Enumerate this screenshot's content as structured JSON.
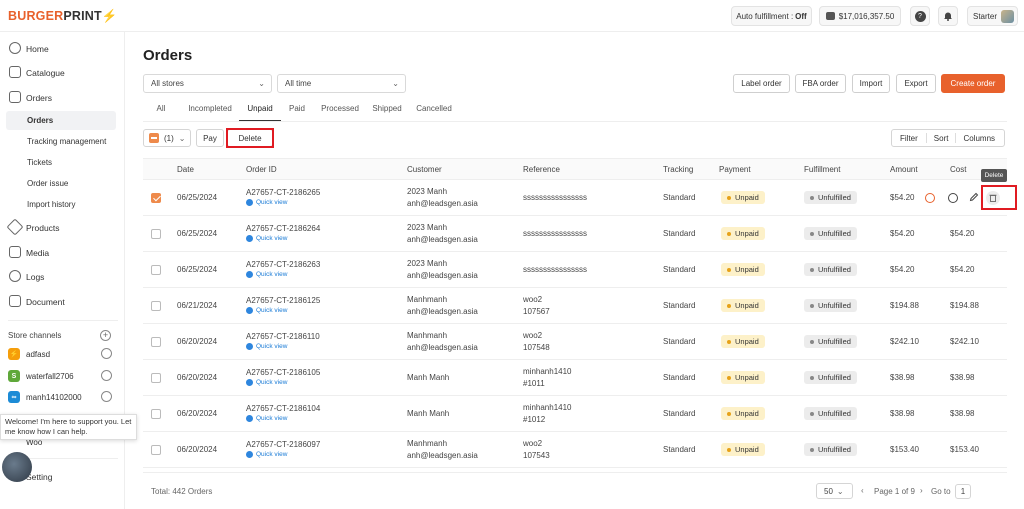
{
  "brand": {
    "name_a": "BURGER",
    "name_b": "PRINT",
    "mark": "⚡"
  },
  "topbar": {
    "auto_fulfillment": "Auto fulfillment : ",
    "auto_fulfillment_state": "Off",
    "balance": "$17,016,357.50",
    "help": "?",
    "plan": "Starter"
  },
  "sidebar": {
    "nav": [
      {
        "label": "Home",
        "icon": "home-icon"
      },
      {
        "label": "Catalogue",
        "icon": "catalogue-icon"
      },
      {
        "label": "Orders",
        "icon": "orders-icon"
      }
    ],
    "orders_sub": [
      "Orders",
      "Tracking management",
      "Tickets",
      "Order issue",
      "Import history"
    ],
    "nav2": [
      {
        "label": "Products",
        "icon": "tag-icon"
      },
      {
        "label": "Media",
        "icon": "image-icon"
      },
      {
        "label": "Logs",
        "icon": "history-icon"
      },
      {
        "label": "Document",
        "icon": "book-icon"
      }
    ],
    "store_channels_label": "Store channels",
    "stores": [
      {
        "name": "adfasd",
        "color": "#f59e0b",
        "glyph": "⚡"
      },
      {
        "name": "waterfall2706",
        "color": "#5fa83a",
        "glyph": "S"
      },
      {
        "name": "manh14102000",
        "color": "#1c8bd6",
        "glyph": "∞"
      }
    ],
    "welcome": "Welcome! I'm here to support you. Let me know how I can help.",
    "hidden_store": "Woo",
    "setting": "Setting"
  },
  "main": {
    "title": "Orders",
    "filters": {
      "store": "All stores",
      "time": "All time"
    },
    "actions": {
      "label_order": "Label order",
      "fba_order": "FBA order",
      "import": "Import",
      "export": "Export",
      "create": "Create order"
    },
    "tabs": [
      "All",
      "Incompleted",
      "Unpaid",
      "Paid",
      "Processed",
      "Shipped",
      "Cancelled"
    ],
    "active_tab": "Unpaid",
    "bulk": {
      "count": "(1)",
      "pay": "Pay",
      "delete": "Delete"
    },
    "view": {
      "filter": "Filter",
      "sort": "Sort",
      "columns": "Columns"
    },
    "columns": [
      "Date",
      "Order ID",
      "Customer",
      "Reference",
      "Tracking",
      "Payment",
      "Fulfillment",
      "Amount",
      "Cost"
    ],
    "quick_view": "Quick view",
    "delete_tooltip": "Delete",
    "rows": [
      {
        "date": "06/25/2024",
        "id": "A27657-CT-2186265",
        "cust1": "2023 Manh",
        "cust2": "anh@leadsgen.asia",
        "ref1": "ssssssssssssssss",
        "ref2": "",
        "tracking": "Standard",
        "payment": "Unpaid",
        "fulfillment": "Unfulfilled",
        "amount": "$54.20",
        "cost": "",
        "checked": true
      },
      {
        "date": "06/25/2024",
        "id": "A27657-CT-2186264",
        "cust1": "2023 Manh",
        "cust2": "anh@leadsgen.asia",
        "ref1": "ssssssssssssssss",
        "ref2": "",
        "tracking": "Standard",
        "payment": "Unpaid",
        "fulfillment": "Unfulfilled",
        "amount": "$54.20",
        "cost": "$54.20",
        "checked": false
      },
      {
        "date": "06/25/2024",
        "id": "A27657-CT-2186263",
        "cust1": "2023 Manh",
        "cust2": "anh@leadsgen.asia",
        "ref1": "ssssssssssssssss",
        "ref2": "",
        "tracking": "Standard",
        "payment": "Unpaid",
        "fulfillment": "Unfulfilled",
        "amount": "$54.20",
        "cost": "$54.20",
        "checked": false
      },
      {
        "date": "06/21/2024",
        "id": "A27657-CT-2186125",
        "cust1": "Manhmanh",
        "cust2": "anh@leadsgen.asia",
        "ref1": "woo2",
        "ref2": "107567",
        "tracking": "Standard",
        "payment": "Unpaid",
        "fulfillment": "Unfulfilled",
        "amount": "$194.88",
        "cost": "$194.88",
        "checked": false
      },
      {
        "date": "06/20/2024",
        "id": "A27657-CT-2186110",
        "cust1": "Manhmanh",
        "cust2": "anh@leadsgen.asia",
        "ref1": "woo2",
        "ref2": "107548",
        "tracking": "Standard",
        "payment": "Unpaid",
        "fulfillment": "Unfulfilled",
        "amount": "$242.10",
        "cost": "$242.10",
        "checked": false
      },
      {
        "date": "06/20/2024",
        "id": "A27657-CT-2186105",
        "cust1": "Manh Manh",
        "cust2": "",
        "ref1": "minhanh1410",
        "ref2": "#1011",
        "tracking": "Standard",
        "payment": "Unpaid",
        "fulfillment": "Unfulfilled",
        "amount": "$38.98",
        "cost": "$38.98",
        "checked": false
      },
      {
        "date": "06/20/2024",
        "id": "A27657-CT-2186104",
        "cust1": "Manh Manh",
        "cust2": "",
        "ref1": "minhanh1410",
        "ref2": "#1012",
        "tracking": "Standard",
        "payment": "Unpaid",
        "fulfillment": "Unfulfilled",
        "amount": "$38.98",
        "cost": "$38.98",
        "checked": false
      },
      {
        "date": "06/20/2024",
        "id": "A27657-CT-2186097",
        "cust1": "Manhmanh",
        "cust2": "anh@leadsgen.asia",
        "ref1": "woo2",
        "ref2": "107543",
        "tracking": "Standard",
        "payment": "Unpaid",
        "fulfillment": "Unfulfilled",
        "amount": "$153.40",
        "cost": "$153.40",
        "checked": false
      }
    ],
    "footer": {
      "total": "Total: 442 Orders",
      "per_page": "50",
      "page_info": "Page 1 of 9",
      "goto": "Go to",
      "goto_value": "1"
    }
  }
}
